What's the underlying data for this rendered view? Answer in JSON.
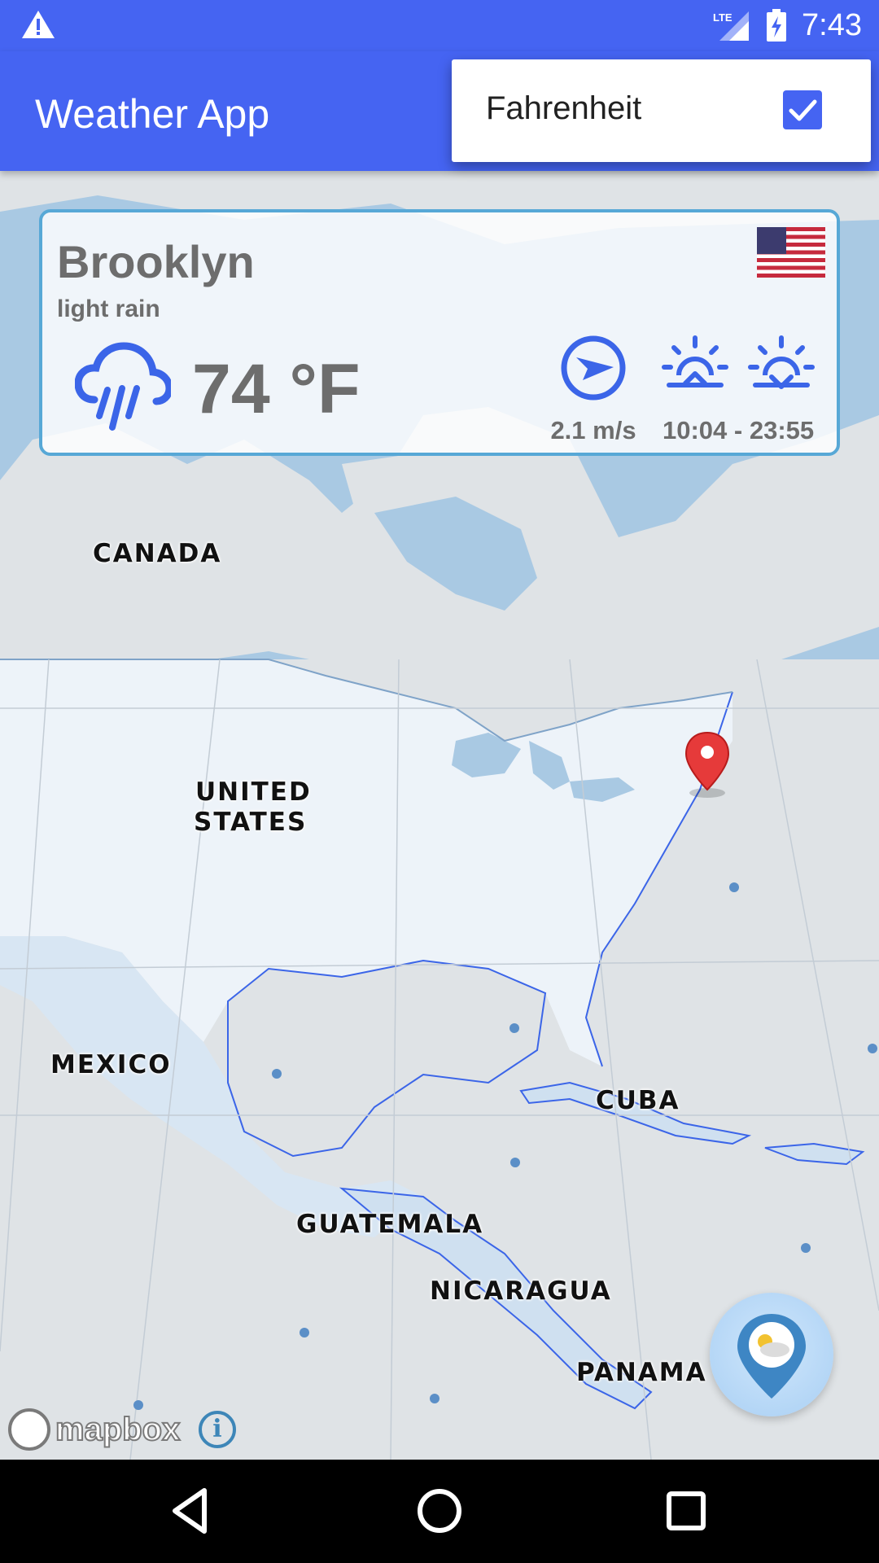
{
  "status_bar": {
    "time": "7:43",
    "network": "LTE",
    "icons": [
      "alert-icon",
      "signal-icon",
      "battery-charging-icon"
    ]
  },
  "app_bar": {
    "title": "Weather App"
  },
  "menu": {
    "items": [
      {
        "label": "Fahrenheit",
        "checked": true
      }
    ]
  },
  "weather": {
    "city": "Brooklyn",
    "condition": "light rain",
    "temperature": "74 °F",
    "wind_speed": "2.1 m/s",
    "sun_times": "10:04 - 23:55",
    "icons": [
      "rain-cloud-icon",
      "wind-direction-icon",
      "sunrise-icon",
      "sunset-icon",
      "us-flag-icon"
    ]
  },
  "map": {
    "labels": {
      "canada": "CANADA",
      "united_states_1": "UNITED",
      "united_states_2": "STATES",
      "mexico": "MEXICO",
      "cuba": "CUBA",
      "guatemala": "GUATEMALA",
      "nicaragua": "NICARAGUA",
      "panama": "PANAMA"
    },
    "attribution": "mapbox",
    "info": "i",
    "colors": {
      "water": "#a9c9e3",
      "land": "#dfe3e6",
      "usa": "#edf3f9"
    }
  },
  "nav_bar": {
    "buttons": [
      "back-icon",
      "home-icon",
      "recents-icon"
    ]
  },
  "colors": {
    "primary": "#4564f2",
    "card_border": "#57a8d6",
    "icon_blue": "#3b65e8",
    "text_gray": "#6d6d6d"
  }
}
